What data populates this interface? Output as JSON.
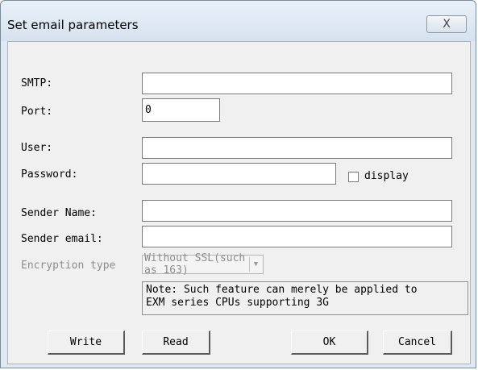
{
  "dialog": {
    "title": "Set email parameters",
    "close_glyph": "X"
  },
  "form": {
    "smtp_label": "SMTP:",
    "smtp_value": "",
    "port_label": "Port:",
    "port_value": "0",
    "user_label": "User:",
    "user_value": "",
    "password_label": "Password:",
    "password_value": "",
    "display_label": "display",
    "display_checked": false,
    "sender_name_label": "Sender Name:",
    "sender_name_value": "",
    "sender_email_label": "Sender email:",
    "sender_email_value": "",
    "encryption_label": "Encryption type",
    "encryption_value": "Without SSL(such as 163)",
    "note": "Note: Such feature can merely be applied to\nEXM series CPUs supporting 3G"
  },
  "buttons": {
    "write": "Write",
    "read": "Read",
    "ok": "OK",
    "cancel": "Cancel"
  }
}
